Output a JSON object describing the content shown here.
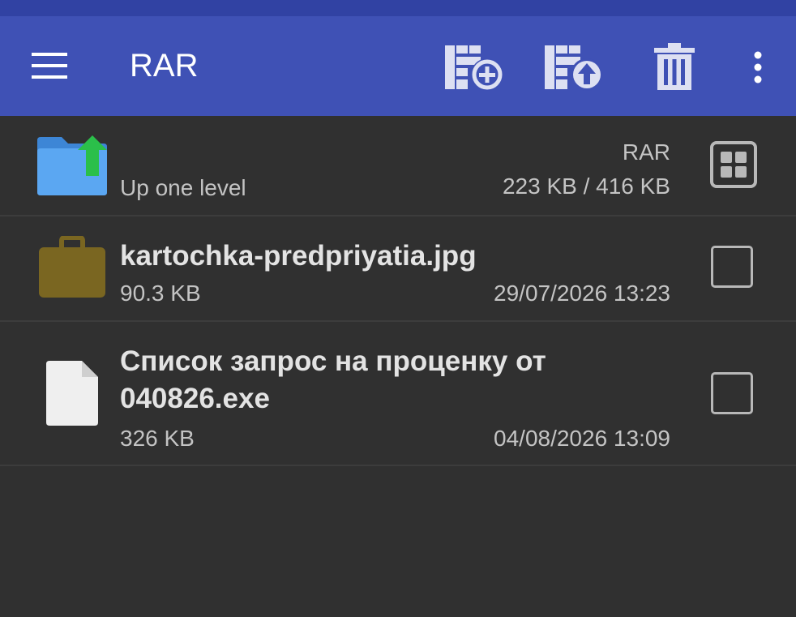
{
  "toolbar": {
    "title": "RAR",
    "icons": [
      "menu-icon",
      "add-to-archive-icon",
      "extract-archive-icon",
      "trash-icon",
      "more-vert-icon"
    ],
    "background": "#3f51b5"
  },
  "parent_row": {
    "label": "Up one level",
    "archive_type": "RAR",
    "size_info": "223 KB / 416 KB"
  },
  "files": [
    {
      "name": "kartochka-predpriyatia.jpg",
      "size": "90.3 KB",
      "date": "29/07/2026 13:23",
      "icon": "briefcase-icon"
    },
    {
      "name": "Список запрос на проценку от 040826.exe",
      "size": "326 KB",
      "date": "04/08/2026 13:09",
      "icon": "file-icon"
    }
  ]
}
